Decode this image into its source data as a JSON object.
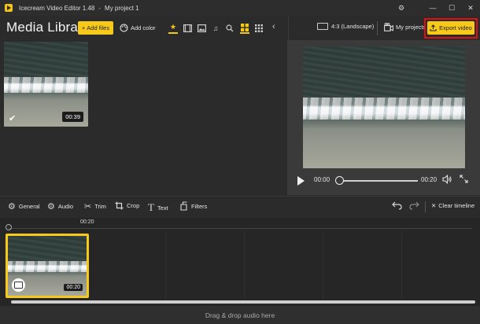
{
  "window": {
    "app_title": "Icecream Video Editor 1.48",
    "separator": "-",
    "project_title": "My project 1",
    "controls": {
      "minimize": "—",
      "maximize": "☐",
      "close": "✕"
    }
  },
  "toolbar": {
    "library_title": "Media Library",
    "add_files_label": "Add files",
    "add_color_label": "Add color",
    "aspect_label": "4:3 (Landscape)",
    "projects_label": "My projects",
    "export_label": "Export video"
  },
  "media": {
    "items": [
      {
        "duration": "00:39",
        "selected": true
      }
    ]
  },
  "player": {
    "current_time": "00:00",
    "total_time": "00:20",
    "progress": 0
  },
  "edit_tools": [
    {
      "label": "General",
      "icon": "gear-icon"
    },
    {
      "label": "Audio",
      "icon": "audio-gear-icon"
    },
    {
      "label": "Trim",
      "icon": "scissors-icon"
    },
    {
      "label": "Crop",
      "icon": "crop-icon"
    },
    {
      "label": "Text",
      "icon": "text-icon"
    },
    {
      "label": "Filters",
      "icon": "filters-icon"
    }
  ],
  "timeline": {
    "ruler_label": "00:20",
    "clear_label": "Clear timeline",
    "clips": [
      {
        "duration": "00:20"
      }
    ],
    "audio_drop_label": "Drag & drop audio here"
  },
  "colors": {
    "accent": "#f7c91b",
    "highlight_outline": "#e01010",
    "background": "#2b2b2b"
  }
}
